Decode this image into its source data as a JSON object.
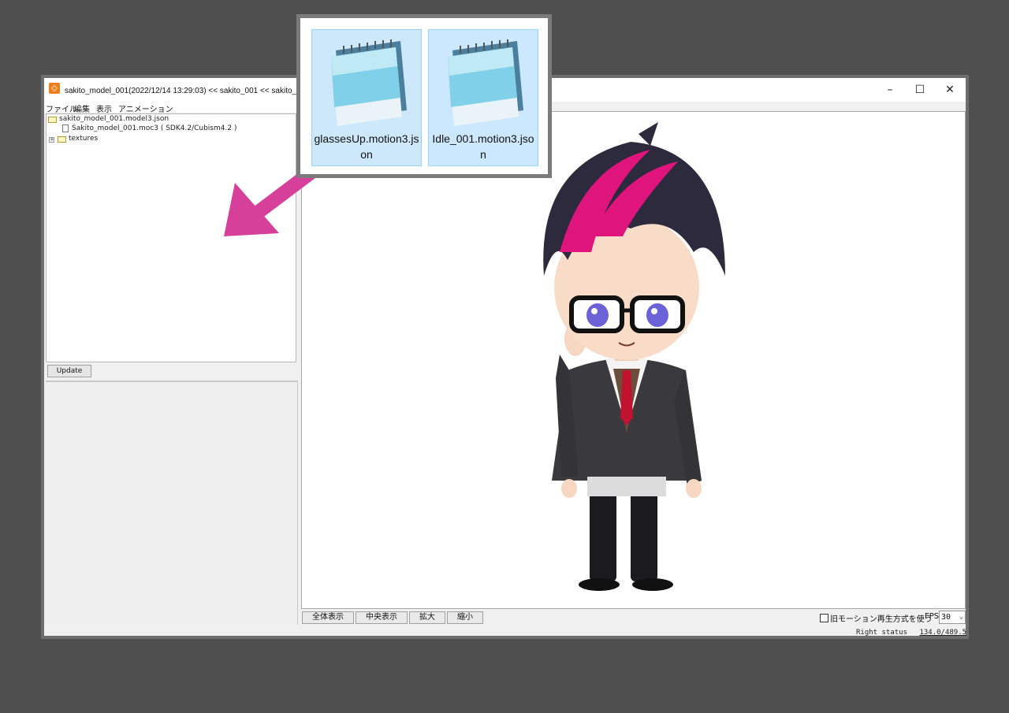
{
  "window": {
    "title": "sakito_model_001(2022/12/14 13:29:03) << sakito_001 << sakito_テス",
    "controls": {
      "minimize": "–",
      "maximize": "☐",
      "close": "✕"
    }
  },
  "menu": [
    "ファイル",
    "編集",
    "表示",
    "アニメーション"
  ],
  "tree": {
    "root": "sakito_model_001.model3.json",
    "moc": "Sakito_model_001.moc3 ( SDK4.2/Cubism4.2 )",
    "textures": "textures",
    "expander": "+"
  },
  "update_button": "Update",
  "viewer_buttons": [
    "全体表示",
    "中央表示",
    "拡大",
    "縮小"
  ],
  "old_motion_label": "旧モーション再生方式を使う",
  "fps": {
    "label": "FPS",
    "value": "30"
  },
  "status": {
    "label": "Right status",
    "coords": "134.0/489.5"
  },
  "dragged_files": [
    {
      "name": "glassesUp.motion3.json"
    },
    {
      "name": "Idle_001.motion3.json"
    }
  ],
  "colors": {
    "arrow": "#d63f9a",
    "accent_hair": "#e0147d",
    "background": "#4f4f4f"
  }
}
